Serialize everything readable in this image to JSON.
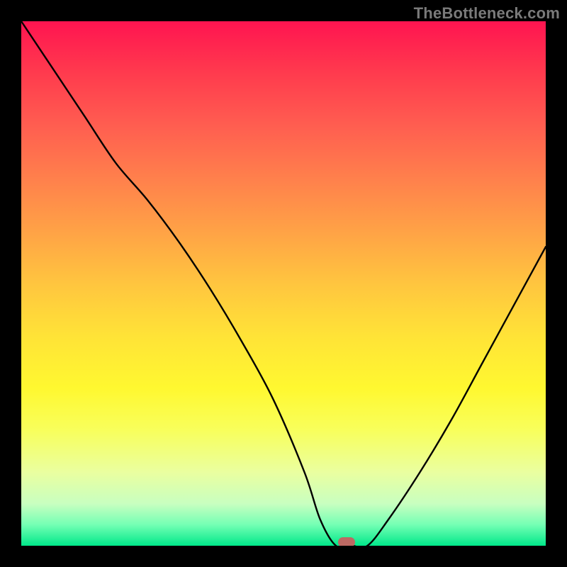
{
  "watermark": "TheBottleneck.com",
  "colors": {
    "frame": "#000000",
    "curve": "#000000",
    "marker": "#bd6963",
    "gradient_top": "#ff1450",
    "gradient_mid": "#ffe337",
    "gradient_bottom": "#00e88a"
  },
  "chart_data": {
    "type": "line",
    "title": "",
    "xlabel": "",
    "ylabel": "",
    "xlim": [
      0,
      100
    ],
    "ylim": [
      0,
      100
    ],
    "series": [
      {
        "name": "bottleneck-curve",
        "x": [
          0,
          6,
          12,
          18,
          24,
          30,
          36,
          42,
          48,
          54,
          57,
          60,
          63,
          66,
          70,
          76,
          82,
          88,
          94,
          100
        ],
        "values": [
          100,
          91,
          82,
          73,
          66,
          58,
          49,
          39,
          28,
          14,
          5,
          0,
          0,
          0,
          5,
          14,
          24,
          35,
          46,
          57
        ]
      }
    ],
    "annotations": [
      {
        "name": "optimal-point",
        "x": 62,
        "y": 0
      }
    ],
    "grid": false,
    "legend": false
  }
}
